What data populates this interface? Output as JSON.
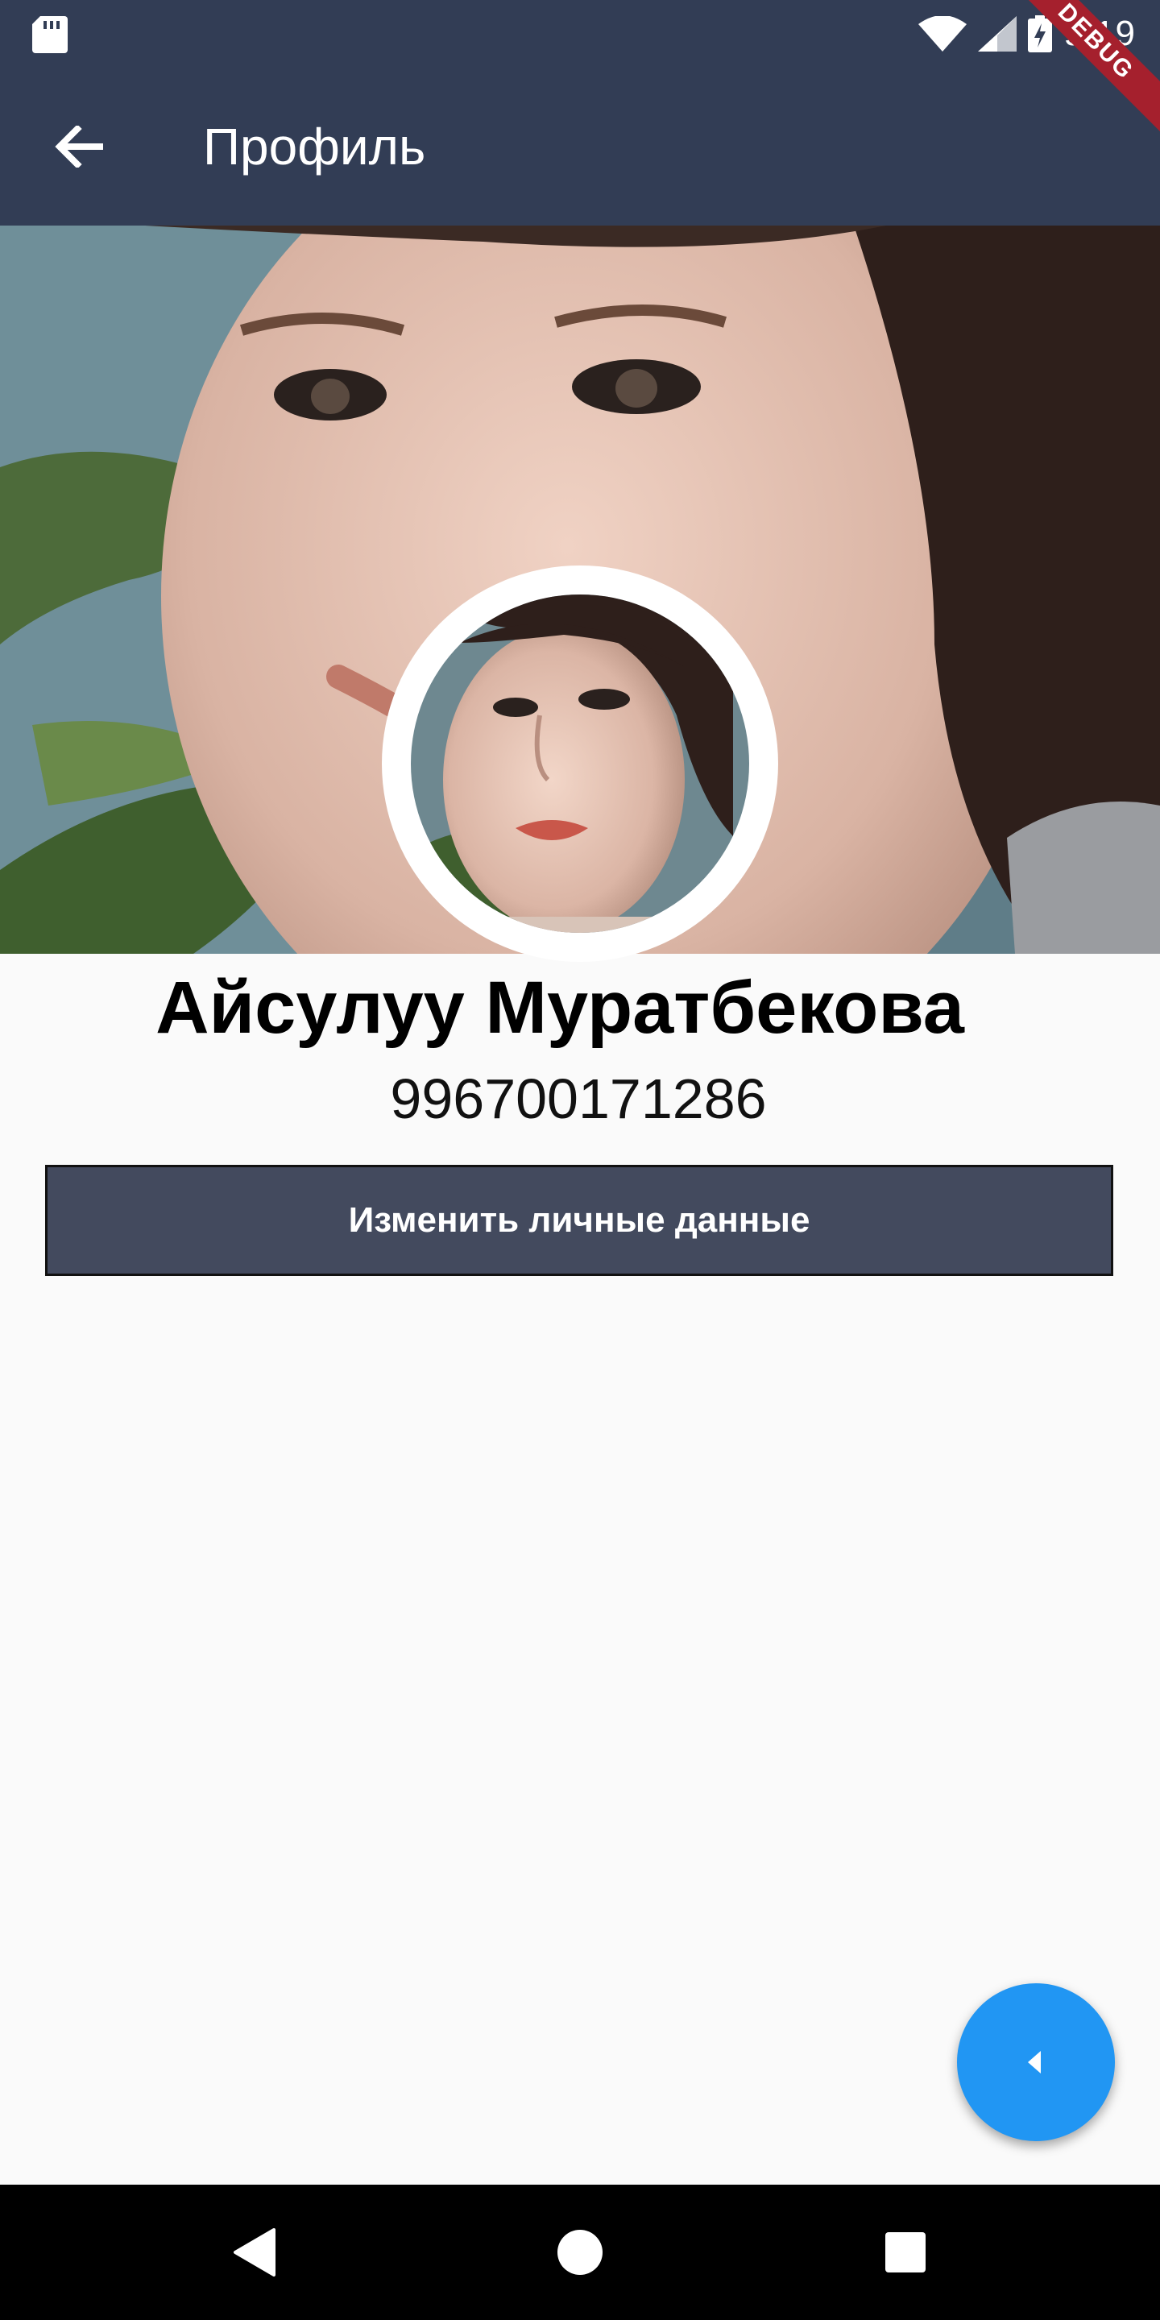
{
  "status_bar": {
    "time": "9:19",
    "icons": [
      "sd-card-icon",
      "wifi-icon",
      "signal-icon",
      "battery-charging-icon"
    ]
  },
  "app_bar": {
    "title": "Профиль",
    "back_icon": "arrow-back-icon",
    "debug_label": "DEBUG"
  },
  "profile": {
    "name": "Айсулуу Муратбекова",
    "phone": "996700171286",
    "edit_button_label": "Изменить личные данные"
  },
  "fab": {
    "icon": "caret-left-icon"
  },
  "nav_bar": {
    "icons": [
      "back-triangle-icon",
      "home-circle-icon",
      "recents-square-icon"
    ]
  },
  "colors": {
    "app_bar": "#323d55",
    "button": "#434a5e",
    "fab": "#2196f3",
    "background": "#fafafa"
  }
}
